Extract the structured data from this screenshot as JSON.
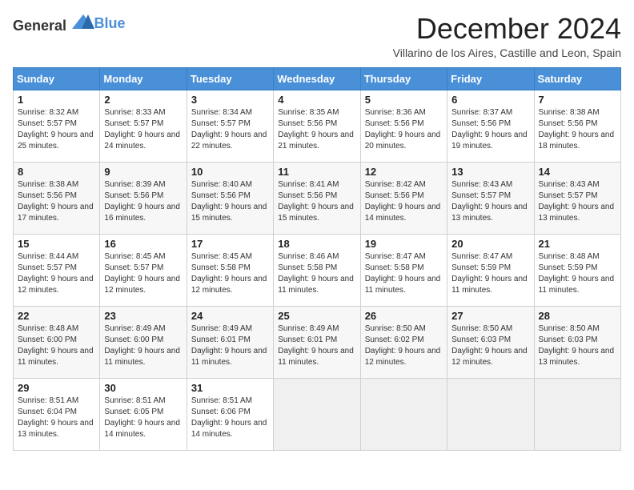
{
  "logo": {
    "text_general": "General",
    "text_blue": "Blue"
  },
  "title": "December 2024",
  "location": "Villarino de los Aires, Castille and Leon, Spain",
  "weekdays": [
    "Sunday",
    "Monday",
    "Tuesday",
    "Wednesday",
    "Thursday",
    "Friday",
    "Saturday"
  ],
  "weeks": [
    [
      {
        "day": 1,
        "sunrise": "8:32 AM",
        "sunset": "5:57 PM",
        "daylight": "9 hours and 25 minutes."
      },
      {
        "day": 2,
        "sunrise": "8:33 AM",
        "sunset": "5:57 PM",
        "daylight": "9 hours and 24 minutes."
      },
      {
        "day": 3,
        "sunrise": "8:34 AM",
        "sunset": "5:57 PM",
        "daylight": "9 hours and 22 minutes."
      },
      {
        "day": 4,
        "sunrise": "8:35 AM",
        "sunset": "5:56 PM",
        "daylight": "9 hours and 21 minutes."
      },
      {
        "day": 5,
        "sunrise": "8:36 AM",
        "sunset": "5:56 PM",
        "daylight": "9 hours and 20 minutes."
      },
      {
        "day": 6,
        "sunrise": "8:37 AM",
        "sunset": "5:56 PM",
        "daylight": "9 hours and 19 minutes."
      },
      {
        "day": 7,
        "sunrise": "8:38 AM",
        "sunset": "5:56 PM",
        "daylight": "9 hours and 18 minutes."
      }
    ],
    [
      {
        "day": 8,
        "sunrise": "8:38 AM",
        "sunset": "5:56 PM",
        "daylight": "9 hours and 17 minutes."
      },
      {
        "day": 9,
        "sunrise": "8:39 AM",
        "sunset": "5:56 PM",
        "daylight": "9 hours and 16 minutes."
      },
      {
        "day": 10,
        "sunrise": "8:40 AM",
        "sunset": "5:56 PM",
        "daylight": "9 hours and 15 minutes."
      },
      {
        "day": 11,
        "sunrise": "8:41 AM",
        "sunset": "5:56 PM",
        "daylight": "9 hours and 15 minutes."
      },
      {
        "day": 12,
        "sunrise": "8:42 AM",
        "sunset": "5:56 PM",
        "daylight": "9 hours and 14 minutes."
      },
      {
        "day": 13,
        "sunrise": "8:43 AM",
        "sunset": "5:57 PM",
        "daylight": "9 hours and 13 minutes."
      },
      {
        "day": 14,
        "sunrise": "8:43 AM",
        "sunset": "5:57 PM",
        "daylight": "9 hours and 13 minutes."
      }
    ],
    [
      {
        "day": 15,
        "sunrise": "8:44 AM",
        "sunset": "5:57 PM",
        "daylight": "9 hours and 12 minutes."
      },
      {
        "day": 16,
        "sunrise": "8:45 AM",
        "sunset": "5:57 PM",
        "daylight": "9 hours and 12 minutes."
      },
      {
        "day": 17,
        "sunrise": "8:45 AM",
        "sunset": "5:58 PM",
        "daylight": "9 hours and 12 minutes."
      },
      {
        "day": 18,
        "sunrise": "8:46 AM",
        "sunset": "5:58 PM",
        "daylight": "9 hours and 11 minutes."
      },
      {
        "day": 19,
        "sunrise": "8:47 AM",
        "sunset": "5:58 PM",
        "daylight": "9 hours and 11 minutes."
      },
      {
        "day": 20,
        "sunrise": "8:47 AM",
        "sunset": "5:59 PM",
        "daylight": "9 hours and 11 minutes."
      },
      {
        "day": 21,
        "sunrise": "8:48 AM",
        "sunset": "5:59 PM",
        "daylight": "9 hours and 11 minutes."
      }
    ],
    [
      {
        "day": 22,
        "sunrise": "8:48 AM",
        "sunset": "6:00 PM",
        "daylight": "9 hours and 11 minutes."
      },
      {
        "day": 23,
        "sunrise": "8:49 AM",
        "sunset": "6:00 PM",
        "daylight": "9 hours and 11 minutes."
      },
      {
        "day": 24,
        "sunrise": "8:49 AM",
        "sunset": "6:01 PM",
        "daylight": "9 hours and 11 minutes."
      },
      {
        "day": 25,
        "sunrise": "8:49 AM",
        "sunset": "6:01 PM",
        "daylight": "9 hours and 11 minutes."
      },
      {
        "day": 26,
        "sunrise": "8:50 AM",
        "sunset": "6:02 PM",
        "daylight": "9 hours and 12 minutes."
      },
      {
        "day": 27,
        "sunrise": "8:50 AM",
        "sunset": "6:03 PM",
        "daylight": "9 hours and 12 minutes."
      },
      {
        "day": 28,
        "sunrise": "8:50 AM",
        "sunset": "6:03 PM",
        "daylight": "9 hours and 13 minutes."
      }
    ],
    [
      {
        "day": 29,
        "sunrise": "8:51 AM",
        "sunset": "6:04 PM",
        "daylight": "9 hours and 13 minutes."
      },
      {
        "day": 30,
        "sunrise": "8:51 AM",
        "sunset": "6:05 PM",
        "daylight": "9 hours and 14 minutes."
      },
      {
        "day": 31,
        "sunrise": "8:51 AM",
        "sunset": "6:06 PM",
        "daylight": "9 hours and 14 minutes."
      },
      null,
      null,
      null,
      null
    ]
  ]
}
